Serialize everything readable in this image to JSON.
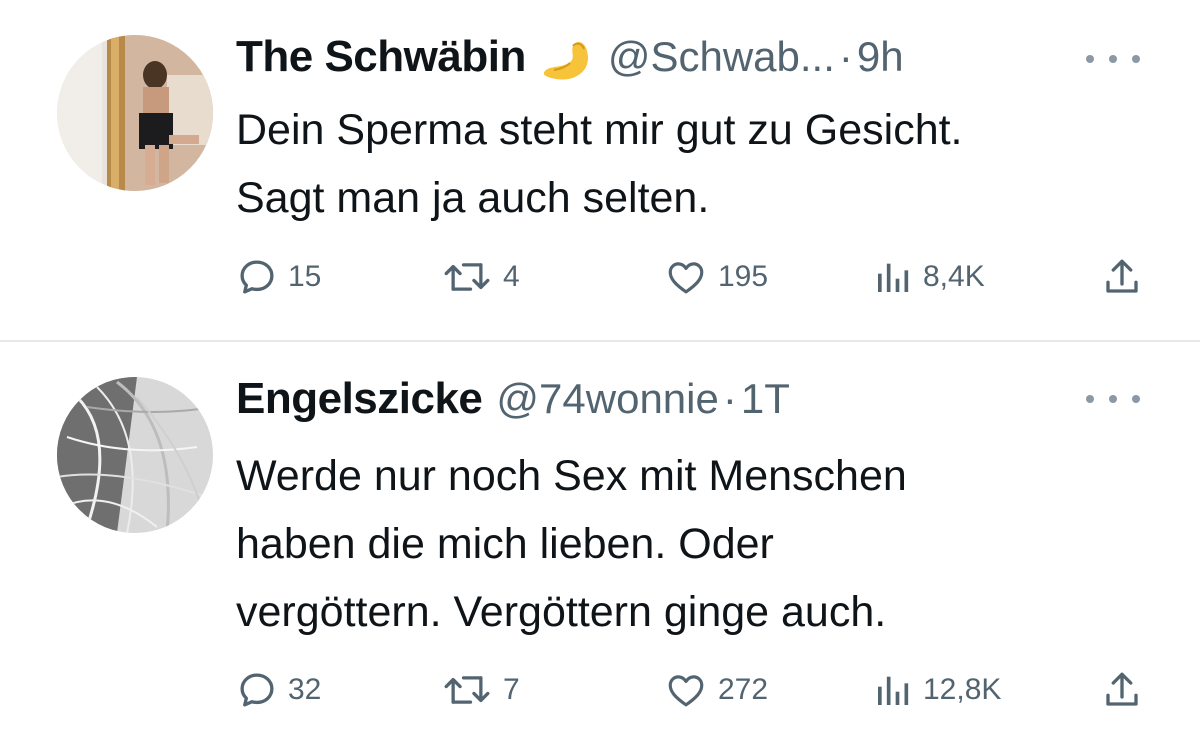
{
  "tweets": [
    {
      "display_name": "The Schwäbin",
      "emoji": "pinched-fingers-emoji",
      "handle": "@Schwab...",
      "separator": "·",
      "time": "9h",
      "lines": [
        "Dein Sperma steht mir gut zu Gesicht.",
        "Sagt man ja auch selten."
      ],
      "replies": "15",
      "retweets": "4",
      "likes": "195",
      "views": "8,4K"
    },
    {
      "display_name": "Engelszicke",
      "handle": "@74wonnie",
      "separator": "·",
      "time": "1T",
      "lines": [
        "Werde nur noch Sex mit Menschen",
        "haben die mich lieben. Oder",
        "vergöttern. Vergöttern ginge auch."
      ],
      "replies": "32",
      "retweets": "7",
      "likes": "272",
      "views": "12,8K"
    }
  ],
  "icons": {
    "reply": "reply-icon",
    "retweet": "retweet-icon",
    "like": "heart-icon",
    "views": "views-icon",
    "share": "share-icon",
    "more": "more-icon"
  },
  "colors": {
    "text": "#0f1419",
    "secondary": "#536471",
    "divider": "#e6e9eb"
  }
}
